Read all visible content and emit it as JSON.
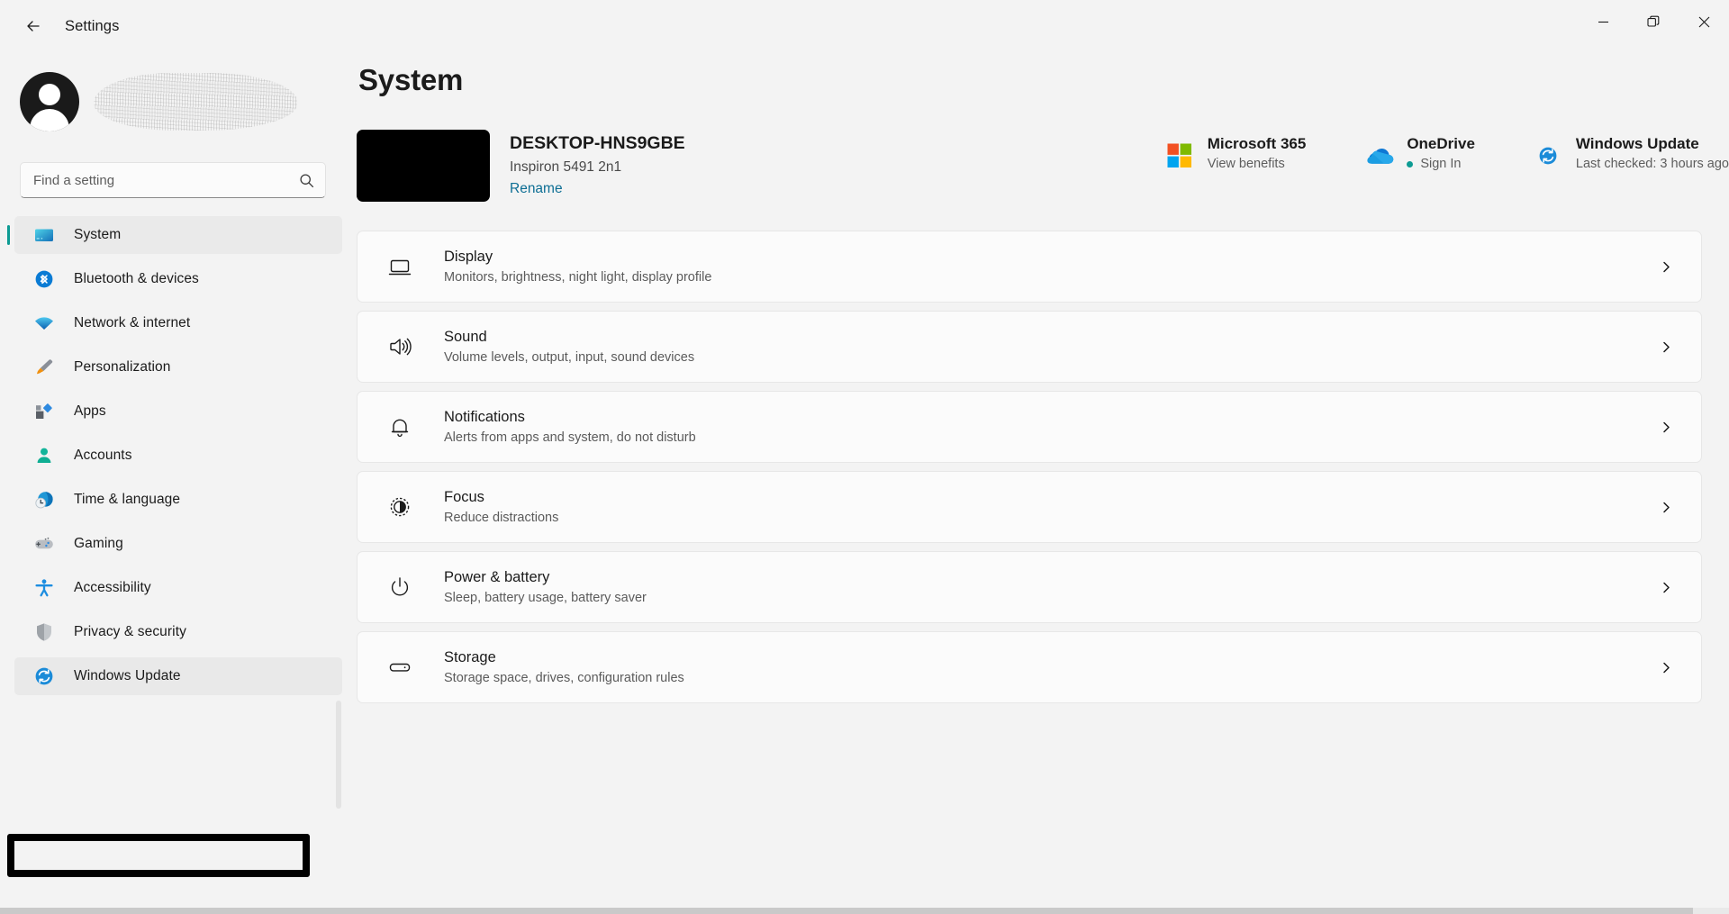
{
  "titlebar": {
    "back_label": "back-arrow",
    "app_title": "Settings",
    "minimize": "minimize",
    "restore": "restore",
    "close": "close"
  },
  "sidebar": {
    "search": {
      "placeholder": "Find a setting",
      "value": ""
    },
    "items": [
      {
        "label": "System",
        "icon": "monitor-icon",
        "state": "selected"
      },
      {
        "label": "Bluetooth & devices",
        "icon": "bluetooth-icon",
        "state": "normal"
      },
      {
        "label": "Network & internet",
        "icon": "wifi-icon",
        "state": "normal"
      },
      {
        "label": "Personalization",
        "icon": "paintbrush-icon",
        "state": "normal"
      },
      {
        "label": "Apps",
        "icon": "apps-icon",
        "state": "normal"
      },
      {
        "label": "Accounts",
        "icon": "person-icon",
        "state": "normal"
      },
      {
        "label": "Time & language",
        "icon": "clock-globe-icon",
        "state": "normal"
      },
      {
        "label": "Gaming",
        "icon": "gamepad-icon",
        "state": "normal"
      },
      {
        "label": "Accessibility",
        "icon": "accessibility-icon",
        "state": "normal"
      },
      {
        "label": "Privacy & security",
        "icon": "shield-icon",
        "state": "normal"
      },
      {
        "label": "Windows Update",
        "icon": "update-refresh-icon",
        "state": "hovered"
      }
    ]
  },
  "main": {
    "page_title": "System",
    "device": {
      "name": "DESKTOP-HNS9GBE",
      "model": "Inspiron 5491 2n1",
      "rename_label": "Rename"
    },
    "status": [
      {
        "title": "Microsoft 365",
        "sub": "View benefits",
        "icon": "microsoft-logo-icon",
        "has_dot": false
      },
      {
        "title": "OneDrive",
        "sub": "Sign In",
        "icon": "onedrive-cloud-icon",
        "has_dot": true
      },
      {
        "title": "Windows Update",
        "sub": "Last checked: 3 hours ago",
        "icon": "update-refresh-icon",
        "has_dot": false
      }
    ],
    "cards": [
      {
        "title": "Display",
        "sub": "Monitors, brightness, night light, display profile",
        "icon": "display-icon"
      },
      {
        "title": "Sound",
        "sub": "Volume levels, output, input, sound devices",
        "icon": "speaker-icon"
      },
      {
        "title": "Notifications",
        "sub": "Alerts from apps and system, do not disturb",
        "icon": "bell-icon"
      },
      {
        "title": "Focus",
        "sub": "Reduce distractions",
        "icon": "focus-icon"
      },
      {
        "title": "Power & battery",
        "sub": "Sleep, battery usage, battery saver",
        "icon": "power-icon"
      },
      {
        "title": "Storage",
        "sub": "Storage space, drives, configuration rules",
        "icon": "drive-icon"
      }
    ]
  },
  "colors": {
    "accent_teal": "#0d9b93",
    "link_blue": "#0d6e94",
    "bg": "#f3f3f3",
    "card_bg": "#fbfbfb",
    "highlight_box": "#000000"
  }
}
